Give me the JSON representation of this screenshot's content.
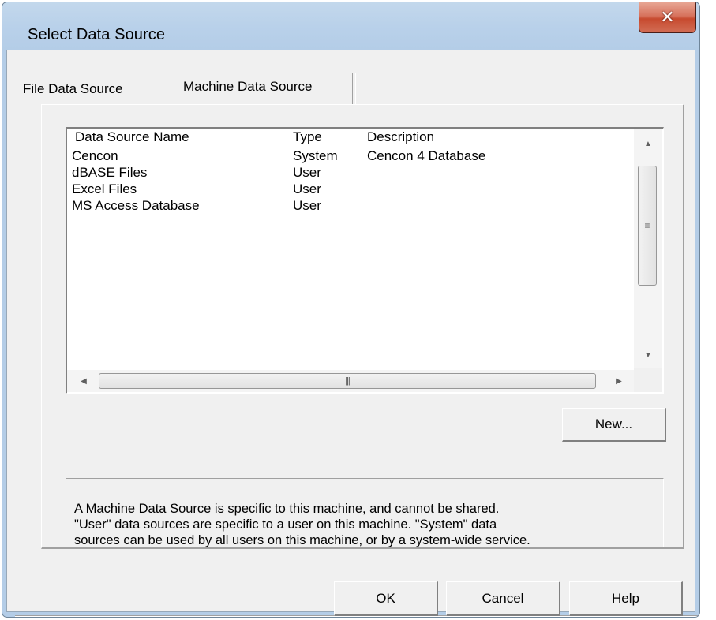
{
  "window": {
    "title": "Select Data Source",
    "close_glyph": "✕"
  },
  "tabs": [
    {
      "label": "File Data Source",
      "active": false
    },
    {
      "label": "Machine Data Source",
      "active": true
    }
  ],
  "list": {
    "columns": [
      "Data Source Name",
      "Type",
      "Description"
    ],
    "rows": [
      {
        "name": "Cencon",
        "type": "System",
        "description": "Cencon 4 Database"
      },
      {
        "name": "dBASE Files",
        "type": "User",
        "description": ""
      },
      {
        "name": "Excel Files",
        "type": "User",
        "description": ""
      },
      {
        "name": "MS Access Database",
        "type": "User",
        "description": ""
      }
    ]
  },
  "buttons": {
    "new": "New...",
    "ok": "OK",
    "cancel": "Cancel",
    "help": "Help"
  },
  "info": {
    "lines": [
      "A Machine Data Source is specific to this machine, and cannot be shared.",
      "\"User\" data sources are specific to a user on this machine.  \"System\" data",
      "sources can be used by all users on this machine, or by a system-wide service."
    ]
  },
  "icons": {
    "scroll_up": "up-arrow-icon",
    "scroll_down": "down-arrow-icon",
    "scroll_left": "left-arrow-icon",
    "scroll_right": "right-arrow-icon"
  },
  "colors": {
    "frame": "#b4cde7",
    "close_button": "#c74a2f",
    "dialog_face": "#f0f0f0"
  }
}
